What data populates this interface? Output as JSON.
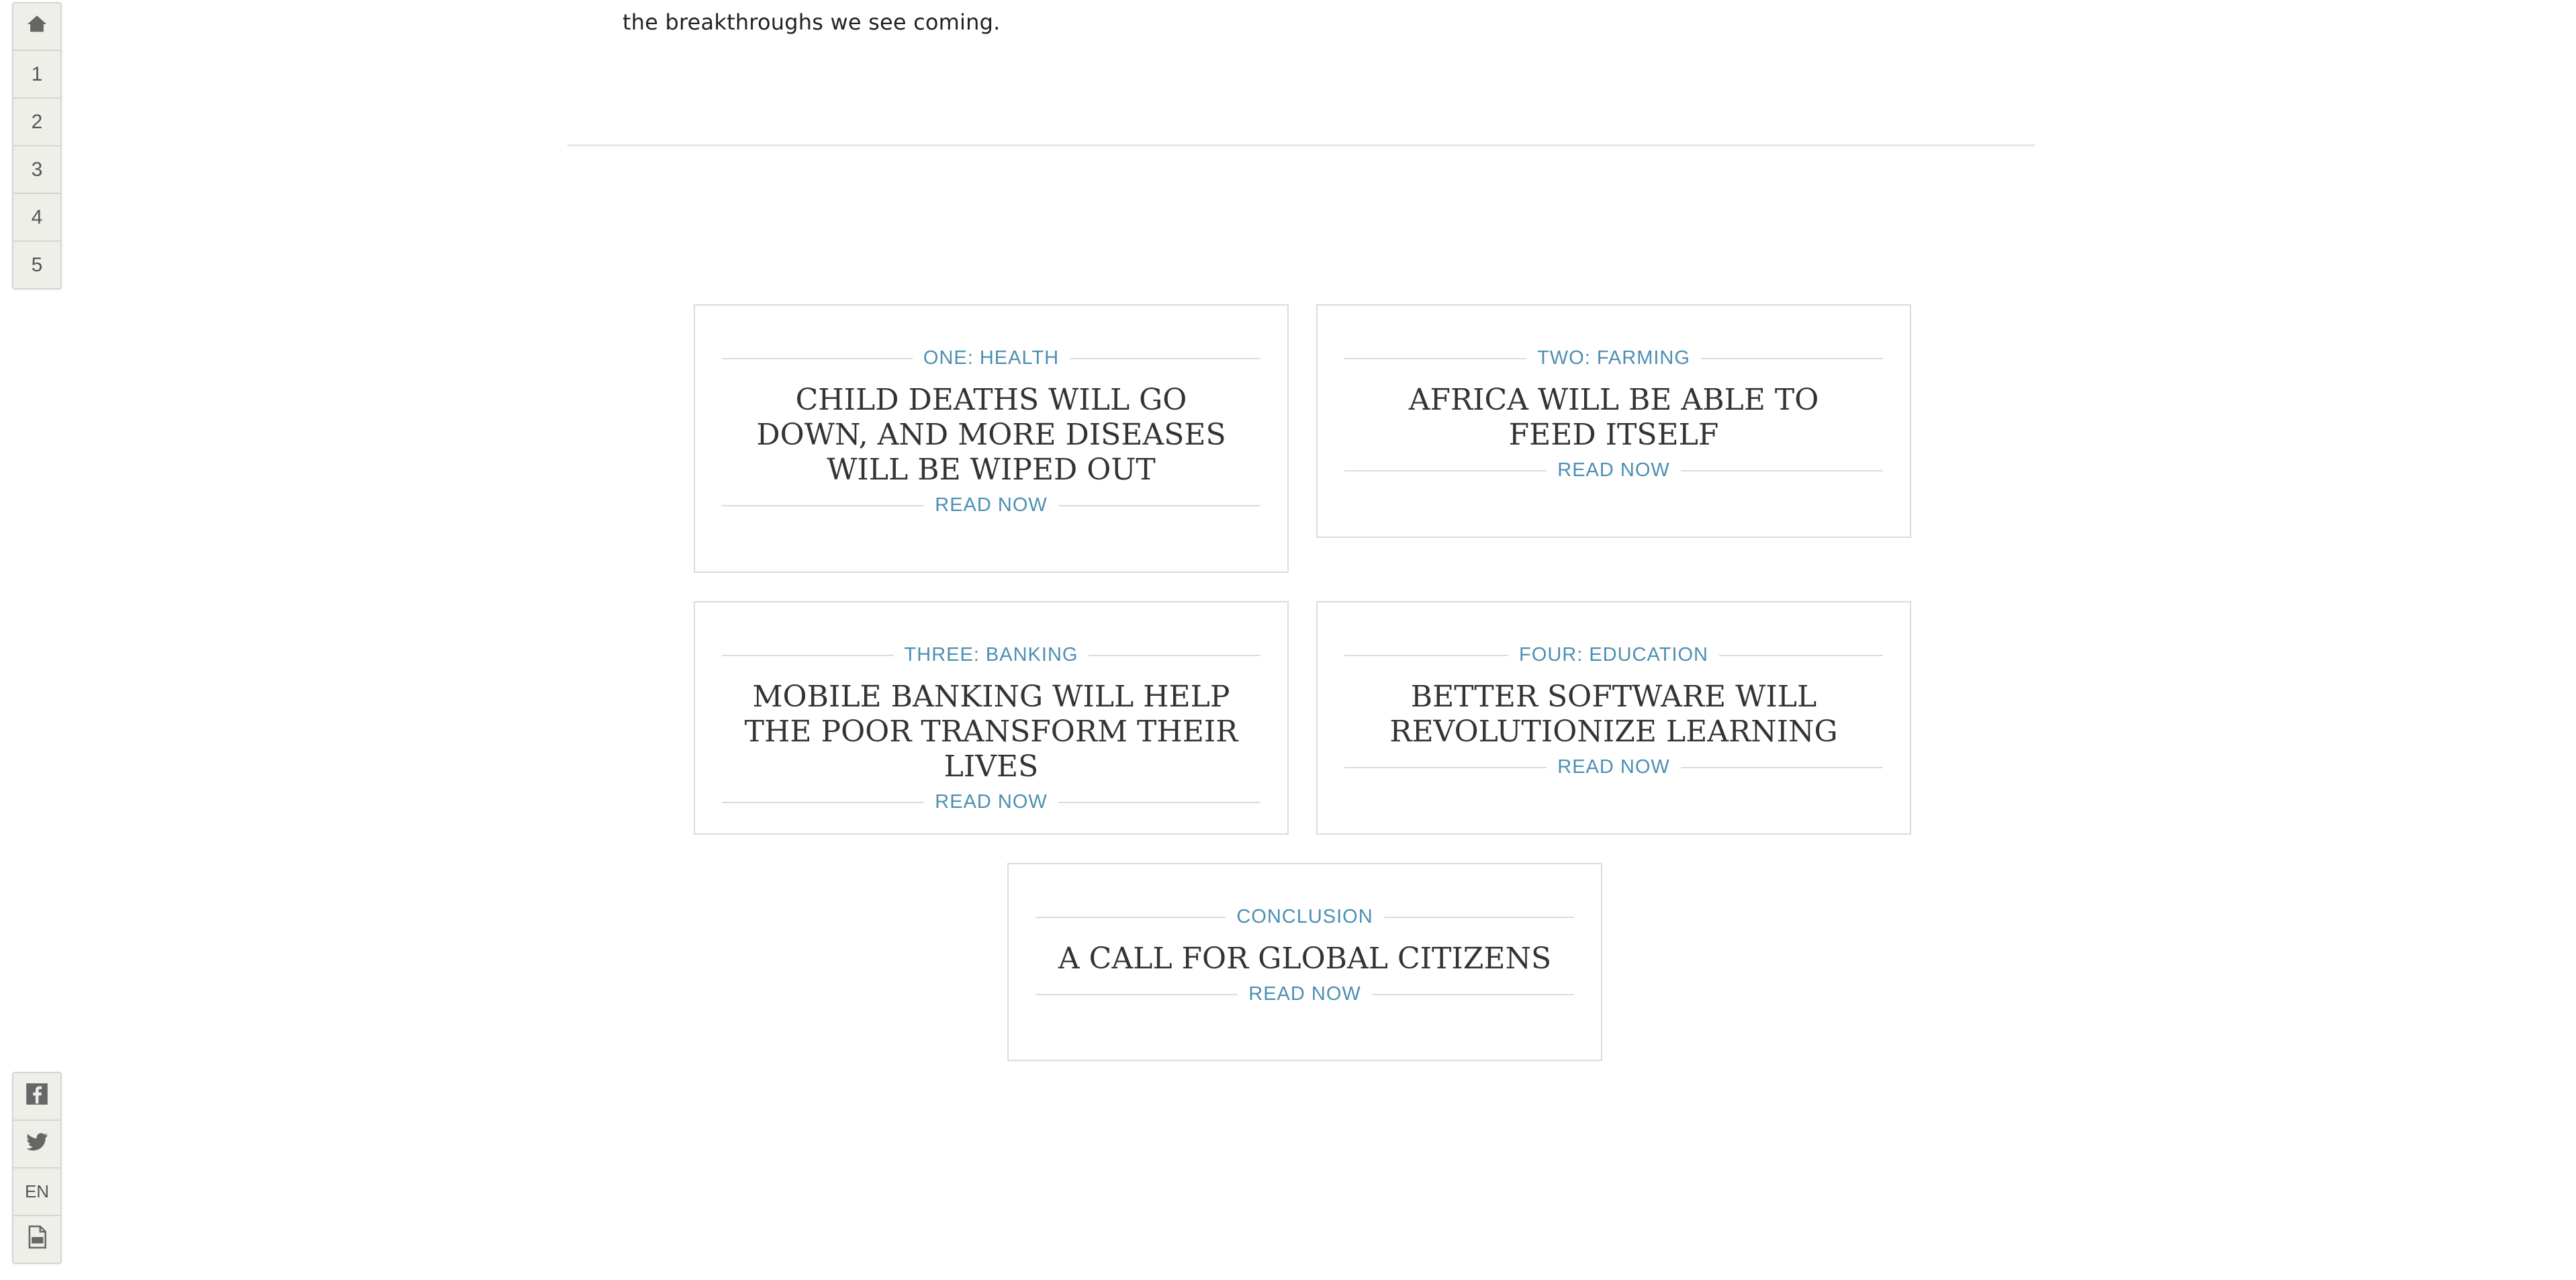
{
  "side_nav": {
    "home_icon": "home-icon",
    "items": [
      "1",
      "2",
      "3",
      "4",
      "5"
    ]
  },
  "side_tools": {
    "facebook_icon": "facebook-icon",
    "twitter_icon": "twitter-icon",
    "language": "EN",
    "pdf_icon": "pdf-icon"
  },
  "intro": {
    "text": "the breakthroughs we see coming."
  },
  "cards": [
    {
      "kicker": "ONE: HEALTH",
      "title": "CHILD DEATHS WILL GO DOWN, AND MORE DISEASES WILL BE WIPED OUT",
      "cta": "READ NOW"
    },
    {
      "kicker": "TWO: FARMING",
      "title": "AFRICA WILL BE ABLE TO FEED ITSELF",
      "cta": "READ NOW"
    },
    {
      "kicker": "THREE: BANKING",
      "title": "MOBILE BANKING WILL HELP THE POOR TRANSFORM THEIR LIVES",
      "cta": "READ NOW"
    },
    {
      "kicker": "FOUR: EDUCATION",
      "title": "BETTER SOFTWARE WILL REVOLUTIONIZE LEARNING",
      "cta": "READ NOW"
    },
    {
      "kicker": "CONCLUSION",
      "title": "A CALL FOR GLOBAL CITIZENS",
      "cta": "READ NOW"
    }
  ],
  "colors": {
    "accent": "#4c8fb1",
    "title": "#333333",
    "border": "#dcdcdc",
    "sidebar_bg": "#efefea"
  }
}
